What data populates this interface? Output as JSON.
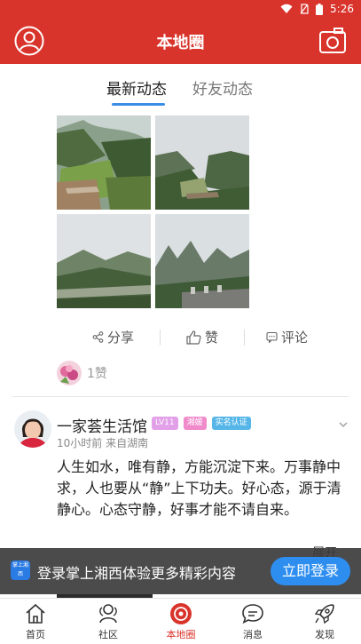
{
  "status_bar": {
    "time": "5:26"
  },
  "header": {
    "title": "本地圈"
  },
  "tabs": [
    {
      "label": "最新动态",
      "active": true
    },
    {
      "label": "好友动态",
      "active": false
    }
  ],
  "post_actions": {
    "share": "分享",
    "like": "赞",
    "comment": "评论"
  },
  "likes": {
    "count": "1赞"
  },
  "post": {
    "author": "一家荟生活馆",
    "badges": [
      "LV11",
      "湘媛",
      "实名认证"
    ],
    "meta": "10小时前  来自湖南",
    "content": "人生如水，唯有静，方能沉淀下来。万事静中求，人也要从“静”上下功夫。好心态，源于清静心。心态守静，好事才能不请自来。",
    "expand": "展开"
  },
  "login_banner": {
    "logo_text": "掌上湘西",
    "text": "登录掌上湘西体验更多精彩内容",
    "button": "立即登录"
  },
  "bottom_nav": [
    {
      "label": "首页",
      "icon": "home-icon"
    },
    {
      "label": "社区",
      "icon": "community-icon"
    },
    {
      "label": "本地圈",
      "icon": "local-circle-icon",
      "active": true
    },
    {
      "label": "消息",
      "icon": "message-icon"
    },
    {
      "label": "发现",
      "icon": "discover-icon"
    }
  ],
  "colors": {
    "brand_red": "#d9342b",
    "accent_blue": "#3a8ee6",
    "login_button": "#2e8ef0"
  }
}
